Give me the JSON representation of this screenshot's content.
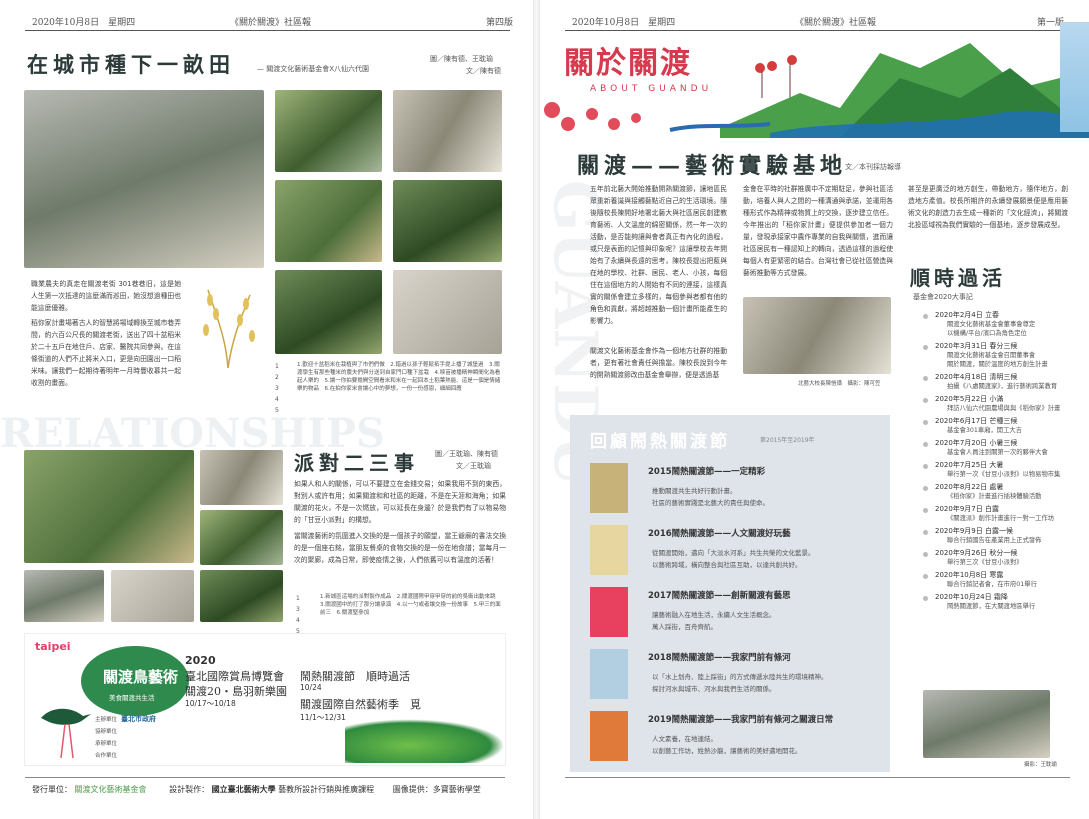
{
  "left": {
    "header_date": "2020年10月8日　星期四",
    "header_title": "《關於關渡》社區報",
    "header_page": "第四版",
    "article1": {
      "title": "在城市種下一畝田",
      "source": "— 關渡文化藝術基金會X八仙六代園",
      "credit_photo": "圖／陳有德、王耽瑜",
      "credit_text": "文／陳有德",
      "p1": "職業農夫的真走在關渡老街 301巷巷旧，這是她人生第一次抵達的這麼滿而巡田，她沒想過種田也能這麼優雅。",
      "p2": "稻你家計畫場著古人的智慧將場域轉換至城市巷弄間，約六百公尺長的關渡老街，送出了四十盆稻米於二十五戶在地住戶、店家、醫院共同參與。在這條街道的人們不止將米入口，更是向田園出一口稻米味。讓我們一起期待著明年一月時豐收慕共一起收割的畫面。",
      "captions": "1.歡迎十盆稻米在栽植與了市們們做　2.錯過以孫子輕鬆拓手提上播了城堡過　3.關渡學生有那些種米的農夫們與分送到自家門口種下盆栽　4.秧苗被播精神瞬間化為看起人樂的　5.讓一你拍要擔開空間看米和米在一起回本土稻葉熱能、這是一個是情緒樂的物品　6.在拍你家米會讓心中的夢想，一份一份感恩，細細回應"
    },
    "ghost1": "RELATIONSHIPS",
    "article2": {
      "title": "派對二三事",
      "credit_photo": "圖／王耽瑜、陳有德",
      "credit_text": "文／王耽瑜",
      "p1": "如果人和人的關係，可以不要建立在金錢交易；如果我用不到的東西，對別人或許有用；如果關渡和和社區的距離，不是在天涯和海角；如果關渡的花火，不是一次燃放，可以延長在身邊？於是我們有了以物易物的「甘豆小派對」的構想。",
      "p2": "當關渡藝術的氛圍進入交換的是一個孩子的願望，當王爺廟的書法交換的是一個座右銘，當朋友餐桌的食物交換的是一份在地食譜；當每月一次的聚廊，成為日常，即使疫情之後，人們依舊可以有溫度的活著！",
      "captions": "1.新城區這場的派對製作成品　2.關渡國際甲穿甲穿的前的吳衛出動來跳　3.關渡國中的打了那分讓承演　4.以一勺或者讓交換一份故事　5.甲三的面前三　6.關渡堅參加"
    },
    "banner": {
      "logo": "taipei",
      "badge": "關渡鳥藝術",
      "badge_sub": "美食關渡共生活",
      "year": "2020",
      "l1": "臺北國際賞鳥博覽會",
      "l2": "關渡20・島羽新樂園",
      "date1": "10/17～10/18",
      "event1": "鬧熱關渡節　順時過活",
      "date2": "10/24",
      "event2": "關渡國際自然藝術季　覓",
      "date3": "11/1～12/31",
      "orgs": [
        "主辦單位",
        "協辦單位",
        "承辦單位",
        "合作單位"
      ],
      "city": "臺北市政府"
    }
  },
  "footer": {
    "publisher_label": "發行單位：",
    "publisher": "關渡文化藝術基金會",
    "design_label": "設計製作：",
    "university": "國立臺北藝術大學",
    "design_dept": "藝教所設計行銷與推廣課程",
    "image_credit": "圖像提供：多寶藝術學堂"
  },
  "right": {
    "header_date": "2020年10月8日　星期四",
    "header_title": "《關於關渡》社區報",
    "header_page": "第一版",
    "masthead": "關於關渡",
    "masthead_en": "ABOUT GUANDU",
    "ghost": "GUANDU",
    "main": {
      "title": "關渡——藝術實驗基地",
      "credit": "文／本刊採訪報導",
      "col1": "五年前北藝大開始推動開熟關渡節，讓地區民眾重新養識與接觸藝點近自己的生活環境。隨後隨校長陳開好地署北藝大與社區居民創建教育藝術、人文溫度的綿密關係，然一年一次的活動，是否能夠讓與會者真正有內化的過程，或只是表面的記憶與印象呢？這讓學校去年開始有了永續與長遠的思考，陳校長提出把藍與在地的學校、社群、居民、老人、小孩，每個住在這個地方的人開始有不同的連接，這樣真實的關係會建立多樣的，每個參與者都有他的角色和貢獻，將超越推動一個計畫所能產生的影響力。",
      "col1b": "關渡文化藝術基金會作為一個地方社群的推動者，更有著社會責任與擔當。陳校長說到今年的開熟關渡節改由基金會舉辦，便是透過基",
      "col2": "金會在平時的社群推廣中不定期駐足，參與社區活動，培養人與人之間的一種溝通與承諾，並運用各種形式作為精神或物質上的交換，逐步建立信任。今年推出的「稻你家計畫」便提供參加者一個力量，發現承接家中農作專業的自我與關懷，進而讓社區居民有一種認知上的轉向，透過這樣的過程使每個人有更緊密的結合。台灣社會已從社區營造與藝術推動等方式發展。",
      "col3": "甚至是更廣泛的地方創生，帶動地方，隨伴地方，創造地方產值。校長所期許的永續發展願景便是應用藝術文化的創造力去生成一種新的「文化經濟」，將關渡北投區域視為我們實驗的一個基地，逐步發展成型。",
      "photo_caption": "北藝大校長陳愷璜　攝影：陳可笠"
    },
    "review": {
      "title": "回顧鬧熱關渡節",
      "subtitle": "第2015年至2019年",
      "items": [
        {
          "title": "2015鬧熱關渡節——一定精彩",
          "b1": "推動關渡共生共好行動計畫。",
          "b2": "社區的藝術實踐是北藝大的責任與使命。"
        },
        {
          "title": "2016鬧熱關渡節——人文關渡好玩藝",
          "b1": "從關渡開始，邁向「大淡水河系」共生共榮的文化藍景。",
          "b2": "以藝術跨域，橫向整合與社區互助，以達共創共好。"
        },
        {
          "title": "2017鬧熱關渡節——創新關渡有藝思",
          "b1": "讓藝術融入在地生活，永續人文生活概念。",
          "b2": "萬人踩街，百舟齊航。"
        },
        {
          "title": "2018鬧熱關渡節——我家門前有條河",
          "b1": "以「水上划舟、陸上踩街」的方式傳遞水陸共生的環境精神。",
          "b2": "探討河水與城市、河水與我們生活的關係。"
        },
        {
          "title": "2019鬧熱關渡節——我家門前有條河之關渡日常",
          "b1": "人文素養，在地連結。",
          "b2": "以創藝工作坊，姓熱沙龍，讓藝術的美好邁地開花。"
        }
      ]
    },
    "shunshi": {
      "title": "順時過活",
      "subtitle": "基金會2020大事記",
      "events": [
        {
          "date": "2020年2月4日 立春",
          "desc": "關渡文化藝術基金會董事會尊定",
          "desc2": "以機構/平台/濱口為角色定位"
        },
        {
          "date": "2020年3月31日 春分三候",
          "desc": "關渡文化藝術基金會召開董事會",
          "desc2": "關於關渡，關於溫度的地方創生計畫"
        },
        {
          "date": "2020年4月18日 清明三候",
          "desc": "拍攝《八處關渡家》，進行藝術跨業教育"
        },
        {
          "date": "2020年5月22日 小滿",
          "desc": "拜訪八仙六代園農場與與《稻你家》計畫"
        },
        {
          "date": "2020年6月17日 芒種三候",
          "desc": "基金會301車廂，開工大吉"
        },
        {
          "date": "2020年7月20日 小暑三候",
          "desc": "基金會人員注到關第一次的夥伴大會"
        },
        {
          "date": "2020年7月25日 大暑",
          "desc": "舉行第一次《甘豆小派對》以物易物市集"
        },
        {
          "date": "2020年8月22日 處暑",
          "desc": "《稻你家》計畫進行插秧體驗活動"
        },
        {
          "date": "2020年9月7日 白露",
          "desc": "《關渡派》創作計畫進行一對一工作坊"
        },
        {
          "date": "2020年9月9日 白露一候",
          "desc": "聯合行銷國告在產業用上正式發佈"
        },
        {
          "date": "2020年9月26日 秋分一候",
          "desc": "舉行第三次《甘豆小派對》"
        },
        {
          "date": "2020年10月8日 寒露",
          "desc": "聯合行銷記者會，在市府01舉行"
        },
        {
          "date": "2020年10月24日 霜降",
          "desc": "鬧熱關渡節，在大關渡地區舉行"
        }
      ],
      "photo_caption": "攝影：王耽瑜"
    }
  }
}
